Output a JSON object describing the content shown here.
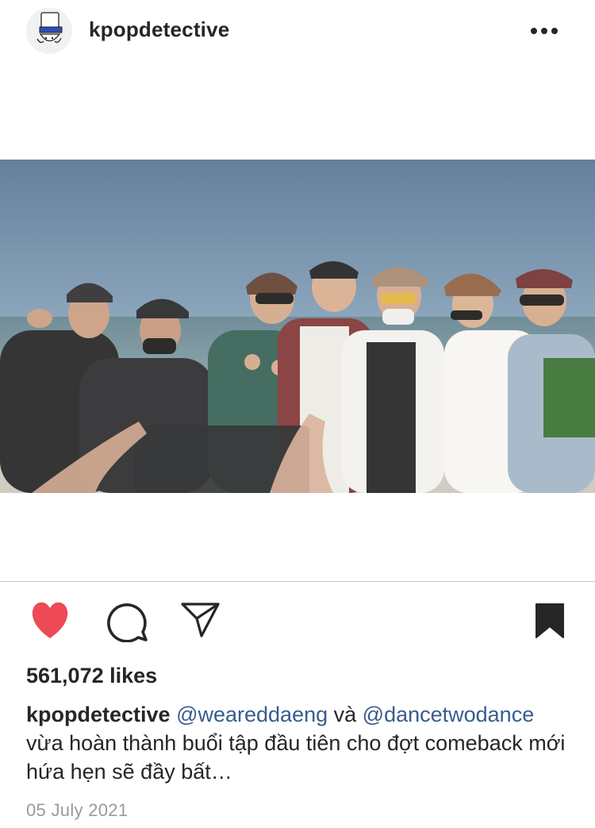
{
  "post": {
    "username": "kpopdetective",
    "more_icon": "more-horizontal-icon",
    "likes_text": "561,072 likes",
    "caption": {
      "username": "kpopdetective",
      "mention_1": "@wearedda​eng",
      "text_1": " và ",
      "mention_2": "@dancetwodance",
      "text_2": " vừa hoàn thành buổi tập đầu tiên cho đợt comeback mới hứa hẹn sẽ đầy bất…"
    },
    "date": "05 July 2021",
    "actions": {
      "like_icon": "heart-filled-icon",
      "comment_icon": "comment-icon",
      "share_icon": "paper-plane-icon",
      "save_icon": "bookmark-filled-icon"
    }
  },
  "colors": {
    "heart": "#ed4956",
    "text": "#262626",
    "mention": "#385c8e",
    "date": "#9a9a9a"
  }
}
